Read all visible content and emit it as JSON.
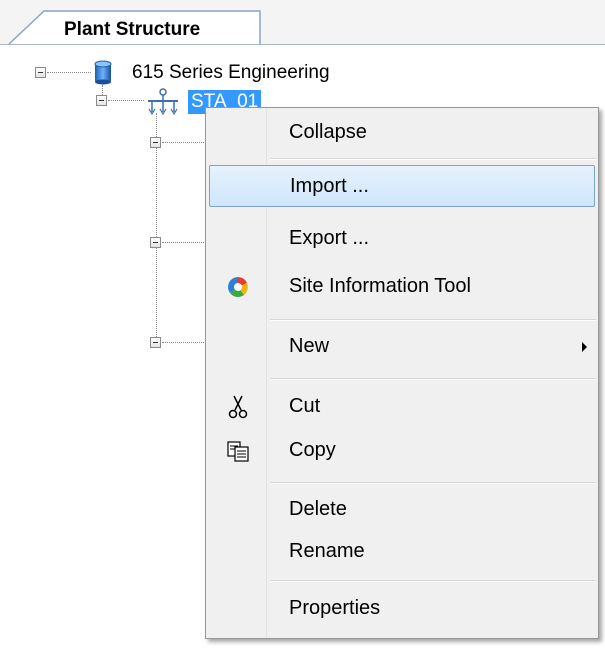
{
  "tab": {
    "label": "Plant Structure"
  },
  "tree": {
    "root_label": "615 Series Engineering",
    "child_label": "STA_01"
  },
  "context_menu": {
    "items": {
      "collapse": "Collapse",
      "import": "Import ...",
      "export": "Export ...",
      "site_info": "Site Information Tool",
      "new": "New",
      "cut": "Cut",
      "copy": "Copy",
      "delete": "Delete",
      "rename": "Rename",
      "properties": "Properties"
    },
    "hovered_item": "import",
    "icons": {
      "site_info": "site-information-icon",
      "cut": "scissors-icon",
      "copy": "copy-icon",
      "new": "submenu-arrow-icon"
    }
  },
  "colors": {
    "selection": "#3399ff",
    "menu_hover": "#cfe6fa",
    "menu_background": "#f0f0f0"
  }
}
